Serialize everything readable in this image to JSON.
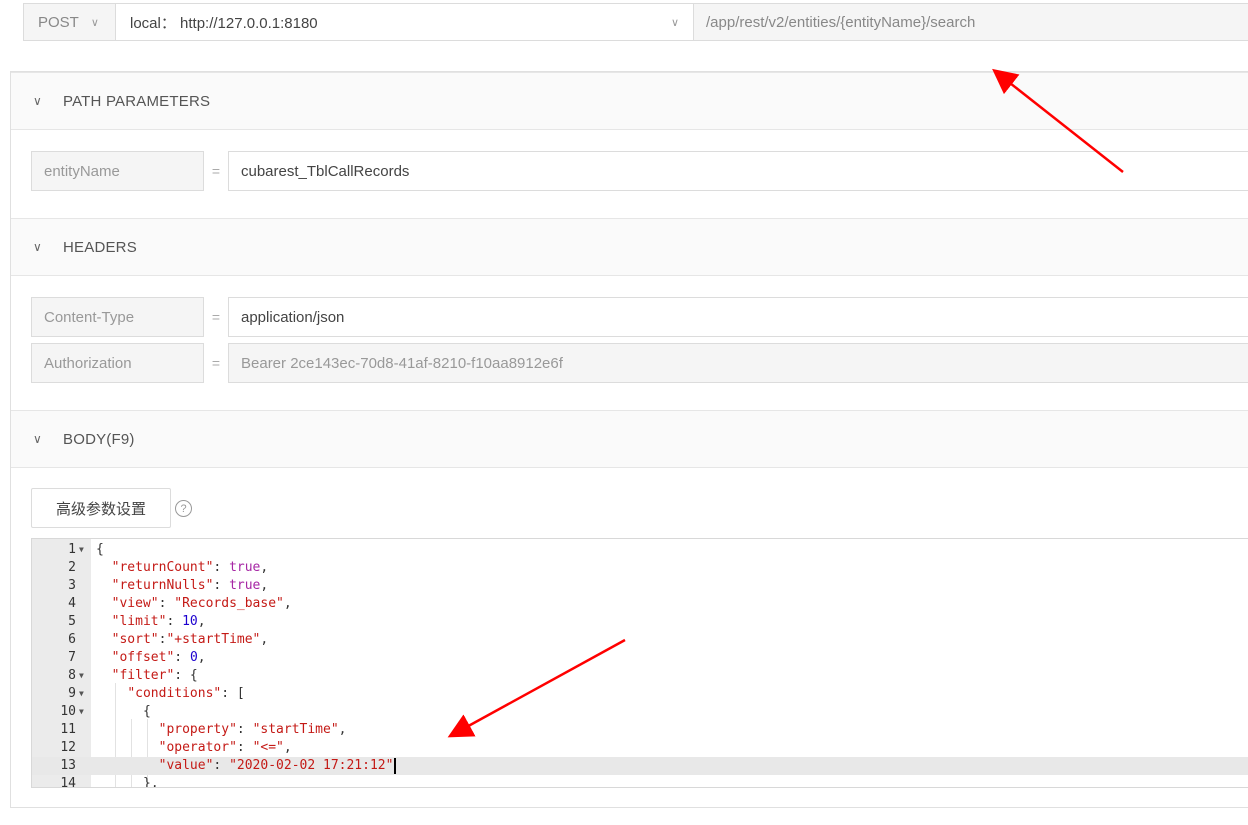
{
  "request": {
    "method": "POST",
    "environment": "local： http://127.0.0.1:8180",
    "path": "/app/rest/v2/entities/{entityName}/search"
  },
  "sections": {
    "path_params": {
      "title": "PATH PARAMETERS"
    },
    "headers": {
      "title": "HEADERS"
    },
    "body": {
      "title": "BODY(F9)"
    }
  },
  "path_params": [
    {
      "key": "entityName",
      "value": "cubarest_TblCallRecords"
    }
  ],
  "headers": [
    {
      "key": "Content-Type",
      "value": "application/json"
    },
    {
      "key": "Authorization",
      "value": "Bearer 2ce143ec-70d8-41af-8210-f10aa8912e6f"
    }
  ],
  "advanced_button": "高级参数设置",
  "help_symbol": "?",
  "equals": "=",
  "editor": {
    "line_numbers": [
      "1",
      "2",
      "3",
      "4",
      "5",
      "6",
      "7",
      "8",
      "9",
      "10",
      "11",
      "12",
      "13",
      "14"
    ]
  },
  "colors": {
    "annotation_arrow": "#ff0000"
  }
}
